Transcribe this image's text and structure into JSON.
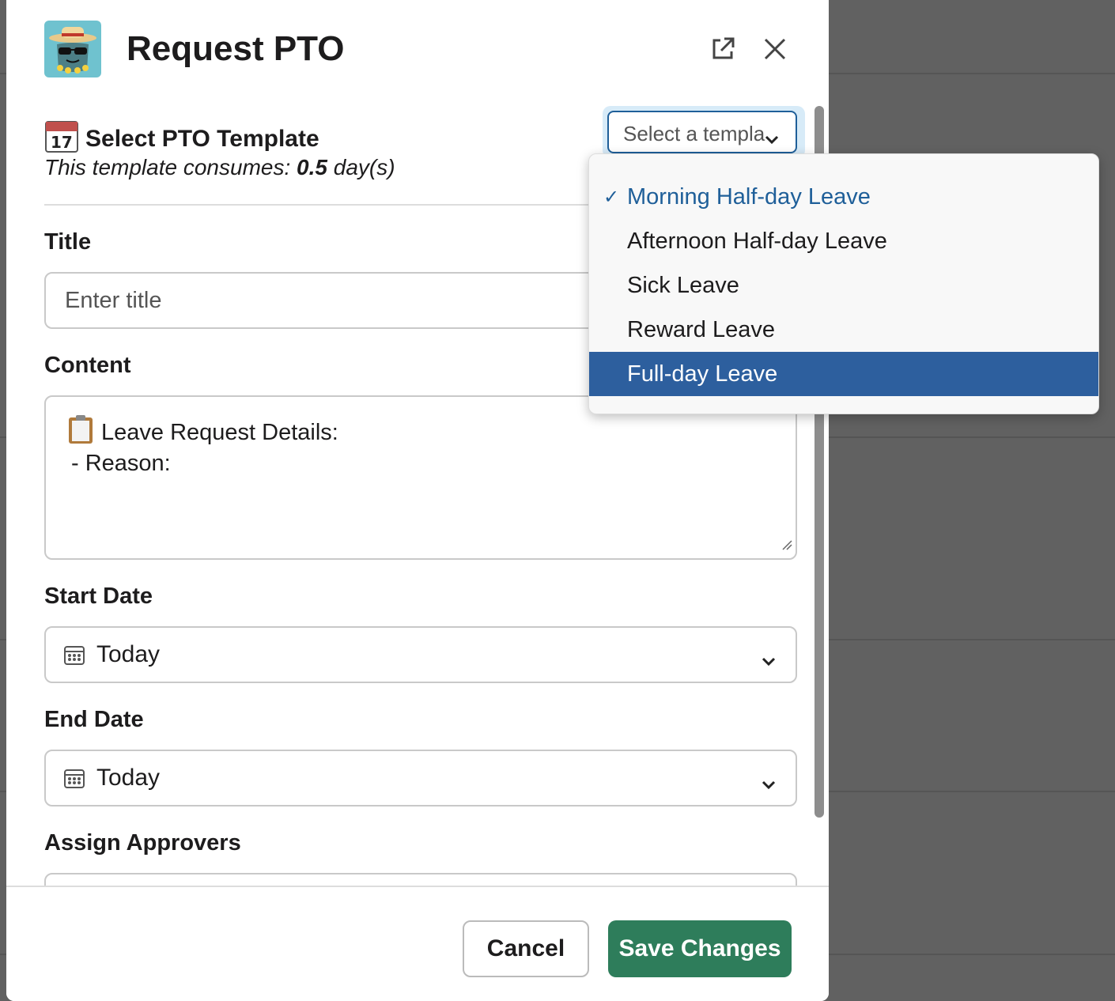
{
  "modal": {
    "title": "Request PTO"
  },
  "template": {
    "heading": "Select PTO Template",
    "consumes_prefix": "This template consumes: ",
    "consumes_value": "0.5",
    "consumes_suffix": " day(s)",
    "select_placeholder": "Select a templa",
    "options": [
      {
        "label": "Morning Half-day Leave",
        "selected": true
      },
      {
        "label": "Afternoon Half-day Leave"
      },
      {
        "label": "Sick Leave"
      },
      {
        "label": "Reward Leave"
      },
      {
        "label": "Full-day Leave",
        "highlighted": true
      }
    ]
  },
  "form": {
    "title_label": "Title",
    "title_placeholder": "Enter title",
    "content_label": "Content",
    "content_line1": "Leave Request Details:",
    "content_line2": "- Reason:",
    "start_label": "Start Date",
    "start_value": "Today",
    "end_label": "End Date",
    "end_value": "Today",
    "approvers_label": "Assign Approvers"
  },
  "footer": {
    "cancel": "Cancel",
    "save": "Save Changes"
  },
  "colors": {
    "accent": "#1f5f99",
    "highlight": "#2d5f9e",
    "save": "#2e7d5b",
    "app_icon_bg": "#6fc2cf"
  }
}
